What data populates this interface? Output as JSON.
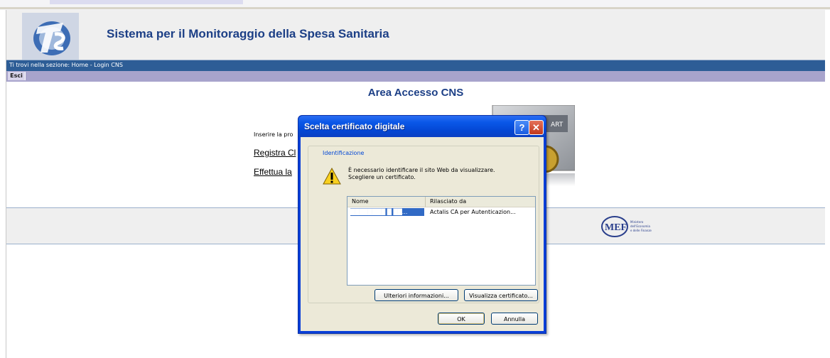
{
  "header": {
    "site_title": "Sistema per il Monitoraggio della Spesa Sanitaria",
    "logo_letters": "TS"
  },
  "nav": {
    "breadcrumb": "Ti trovi nella sezione: Home - Login CNS"
  },
  "menu": {
    "exit_label": "Esci"
  },
  "main": {
    "area_title": "Area Accesso CNS",
    "instruction": "Inserire la pro",
    "link_register": "Registra Cl",
    "link_access": "Effettua la",
    "card_text": "ART ARD"
  },
  "footer": {
    "mef_logo_text": "MEF",
    "mef_lines": [
      "Ministero",
      "dell'Economia",
      "e delle Finanze"
    ]
  },
  "dialog": {
    "title": "Scelta certificato digitale",
    "help_glyph": "?",
    "close_glyph": "✕",
    "group_label": "Identificazione",
    "message_line1": "È necessario identificare il sito Web da visualizzare.",
    "message_line2": "Scegliere un certificato.",
    "columns": [
      "Nome",
      "Rilasciato da"
    ],
    "certificates": [
      {
        "name": "████████ █ ██...",
        "issuer": "Actalis CA per Autenticazion..."
      }
    ],
    "more_info_label": "Ulteriori informazioni...",
    "view_cert_label": "Visualizza certificato...",
    "ok_label": "OK",
    "cancel_label": "Annulla"
  },
  "colors": {
    "title_blue": "#1c3f86",
    "nav_blue": "#2d5d96",
    "menu_lavender": "#a8a4cc",
    "xp_titlebar": "#0a58e8",
    "selection": "#316ac5"
  }
}
